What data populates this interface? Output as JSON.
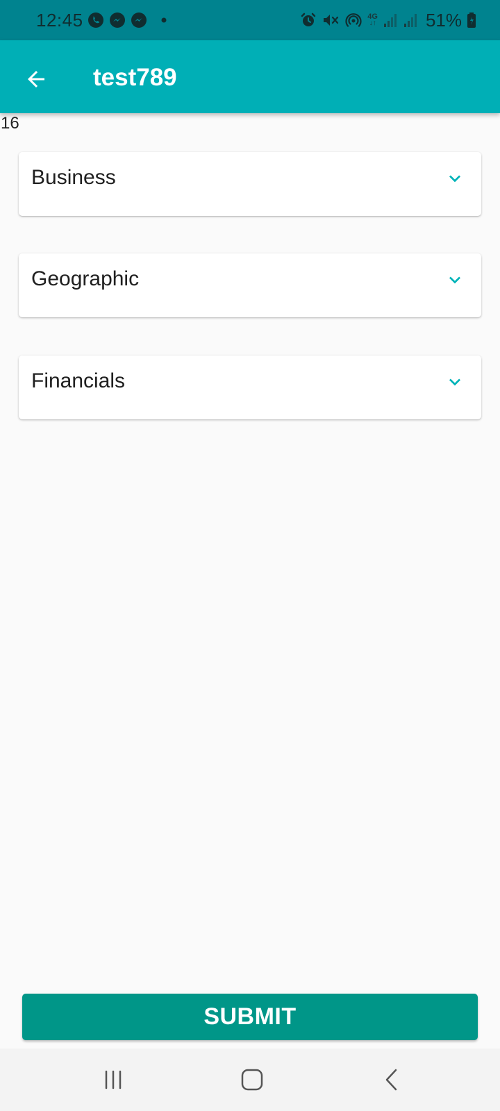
{
  "status_bar": {
    "time": "12:45",
    "network": "4G",
    "battery": "51%",
    "left_icons": [
      "whatsapp-icon",
      "messenger-icon",
      "messenger-icon",
      "more-notifications-dot"
    ],
    "right_icons": [
      "alarm-icon",
      "mute-icon",
      "hotspot-icon",
      "network-4g-icon",
      "signal-icon",
      "signal-icon",
      "battery-icon"
    ]
  },
  "app_bar": {
    "title": "test789",
    "back_icon": "arrow-back-icon",
    "background": "#00afb6"
  },
  "counter": "16",
  "sections": [
    {
      "label": "Business",
      "icon": "chevron-down-icon"
    },
    {
      "label": "Geographic",
      "icon": "chevron-down-icon"
    },
    {
      "label": "Financials",
      "icon": "chevron-down-icon"
    }
  ],
  "submit": {
    "label": "SUBMIT",
    "color": "#009688"
  },
  "nav_bar": {
    "buttons": [
      "recents-icon",
      "home-icon",
      "back-icon"
    ]
  },
  "colors": {
    "status_bar": "#00838f",
    "accent": "#00afb6",
    "chevron": "#00b3b8"
  }
}
